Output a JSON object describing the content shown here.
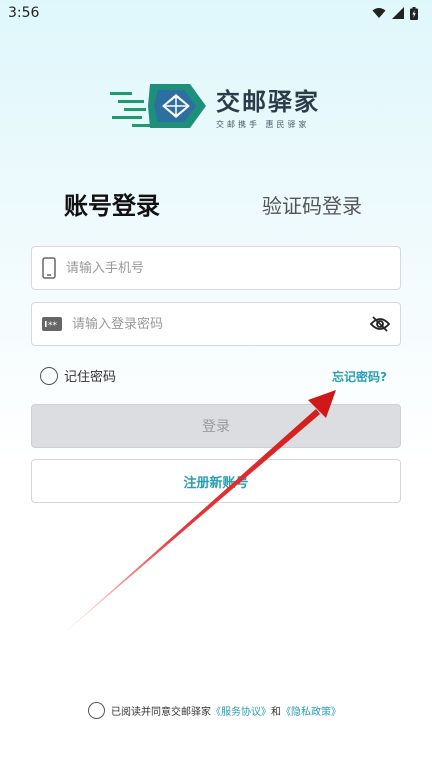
{
  "status_bar": {
    "time": "3:56"
  },
  "logo": {
    "title": "交邮驿家",
    "subtitle": "交邮携手  惠民驿家"
  },
  "tabs": {
    "account": "账号登录",
    "sms": "验证码登录"
  },
  "phone": {
    "placeholder": "请输入手机号"
  },
  "password": {
    "placeholder": "请输入登录密码"
  },
  "remember": {
    "label": "记住密码"
  },
  "forgot": {
    "label": "忘记密码?"
  },
  "buttons": {
    "login": "登录",
    "register": "注册新账号"
  },
  "agreement": {
    "prefix": "已阅读并同意交邮驿家",
    "service": "《服务协议》",
    "and": "和",
    "privacy": "《隐私政策》"
  },
  "colors": {
    "accent": "#2a9fb0",
    "arrow": "#e02020",
    "logo_green": "#1f9a6a",
    "logo_blue": "#2c6fa0"
  }
}
